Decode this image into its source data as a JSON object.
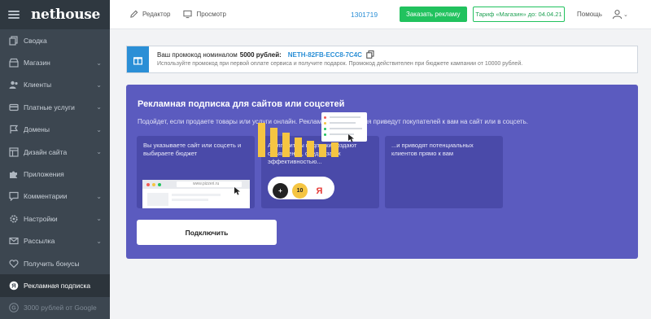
{
  "app": {
    "logo": "nethouse"
  },
  "sidebar": {
    "items": [
      {
        "label": "Сводка",
        "icon": "copy-icon",
        "chevron": false
      },
      {
        "label": "Магазин",
        "icon": "shop-icon",
        "chevron": true
      },
      {
        "label": "Клиенты",
        "icon": "users-icon",
        "chevron": true
      },
      {
        "label": "Платные услуги",
        "icon": "card-icon",
        "chevron": true
      },
      {
        "label": "Домены",
        "icon": "flag-icon",
        "chevron": true
      },
      {
        "label": "Дизайн сайта",
        "icon": "layout-icon",
        "chevron": true
      },
      {
        "label": "Приложения",
        "icon": "puzzle-icon",
        "chevron": false
      },
      {
        "label": "Комментарии",
        "icon": "comment-icon",
        "chevron": true
      },
      {
        "label": "Настройки",
        "icon": "gear-icon",
        "chevron": true
      },
      {
        "label": "Рассылка",
        "icon": "mail-icon",
        "chevron": true
      },
      {
        "label": "Получить бонусы",
        "icon": "heart-icon",
        "chevron": false
      },
      {
        "label": "Рекламная подписка",
        "icon": "yandex-icon",
        "chevron": false,
        "active": true
      },
      {
        "label": "3000 рублей от Google",
        "icon": "google-icon",
        "chevron": false,
        "dim": true
      }
    ]
  },
  "topbar": {
    "editor_label": "Редактор",
    "preview_label": "Просмотр",
    "account_number": "1301719",
    "order_ad_label": "Заказать рекламу",
    "tariff_label": "Тариф «Магазин» до: 04.04.21",
    "help_label": "Помощь"
  },
  "promo": {
    "prefix": "Ваш промокод номиналом",
    "amount": "5000 рублей:",
    "code": "NETH-82FB-ECC8-7C4C",
    "note": "Используйте промокод при первой оплате сервиса и получите подарок. Промокод действителен при бюджете кампании от 10000 рублей."
  },
  "subscription": {
    "title": "Рекламная подписка для сайтов или соцсетей",
    "subtitle": "Подойдет, если продаете товары или услуги онлайн. Рекламные объявления приведут покупателей к вам на сайт или в соцсеть.",
    "steps": [
      {
        "text": "Вы указываете сайт или соцсеть и выбираете бюджет",
        "browser_url": "www.pizzeri.ru"
      },
      {
        "text": "А алгоритмы подписки создают объявления, следят за их эффективностью...",
        "badge_number": "10",
        "badge_letter": "Я"
      },
      {
        "text": "...и приводят потенциальных клиентов прямо к вам"
      }
    ],
    "connect_label": "Подключить"
  },
  "colors": {
    "accent_green": "#21c25e",
    "accent_blue": "#2b8fd6",
    "card_purple": "#5b5bbf",
    "sidebar_bg": "#3c4650"
  }
}
